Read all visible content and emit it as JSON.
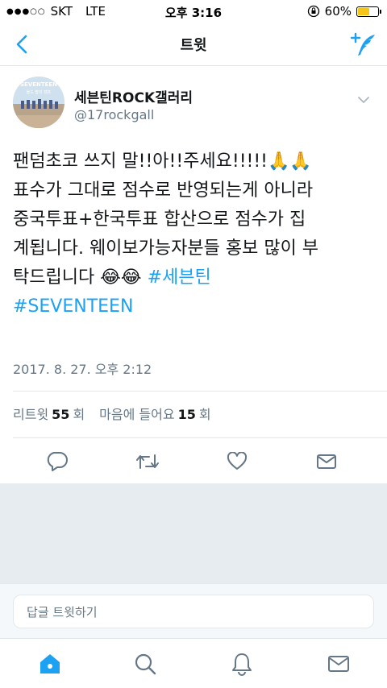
{
  "status_bar": {
    "signal_dots": "●●●○○",
    "carrier": "SKT",
    "network": "LTE",
    "time": "오후 3:16",
    "battery_percent": "60%",
    "battery_level": 0.6
  },
  "nav": {
    "title": "트윗"
  },
  "tweet": {
    "author_name": "세븐틴ROCK갤러리",
    "author_handle": "@17rockgall",
    "avatar_text_line1": "SEVENTEEN",
    "avatar_text_line2": "올드 팝의 캠프",
    "text_main": "팬덤초코 쓰지 말!!아!!주세요!!!!!🙏🙏\n표수가 그대로 점수로 반영되는게 아니라\n중국투표+한국투표 합산으로 점수가 집\n계됩니다. 웨이보가능자분들 홍보 많이 부\n탁드립니다 😂😂 ",
    "hashtag_1": "#세븐틴",
    "hashtag_2": "#SEVENTEEN",
    "timestamp": "2017. 8. 27. 오후 2:12",
    "retweets_label": "리트윗",
    "retweets_count": "55",
    "retweets_unit": "회",
    "likes_label": "마음에 들어요",
    "likes_count": "15",
    "likes_unit": "회"
  },
  "reply": {
    "placeholder": "답글 트윗하기"
  },
  "colors": {
    "accent": "#1da1f2",
    "muted": "#657786",
    "separator": "#e6ecf0"
  }
}
